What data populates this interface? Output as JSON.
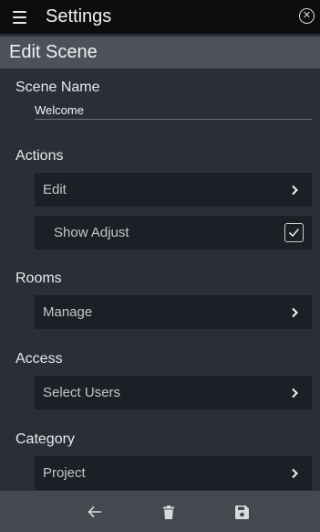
{
  "app": {
    "title": "Settings"
  },
  "header": {
    "title": "Edit Scene"
  },
  "scene_name": {
    "label": "Scene Name",
    "value": "Welcome"
  },
  "actions": {
    "label": "Actions",
    "edit_label": "Edit",
    "show_adjust_label": "Show Adjust",
    "show_adjust_checked": true
  },
  "rooms": {
    "label": "Rooms",
    "manage_label": "Manage"
  },
  "access": {
    "label": "Access",
    "select_users_label": "Select Users"
  },
  "category": {
    "label": "Category",
    "value": "Project"
  },
  "icons": {
    "menu": "hamburger-menu-icon",
    "close": "close-circle-icon",
    "chevron": "chevron-right-icon",
    "check": "check-icon",
    "back": "arrow-left-icon",
    "delete": "trash-icon",
    "save": "floppy-disk-icon"
  },
  "colors": {
    "topbar": "#0c0d0f",
    "subheader": "#4d515a",
    "background": "#2a2e36",
    "row": "#1c1f25",
    "bottombar": "#45494f"
  }
}
